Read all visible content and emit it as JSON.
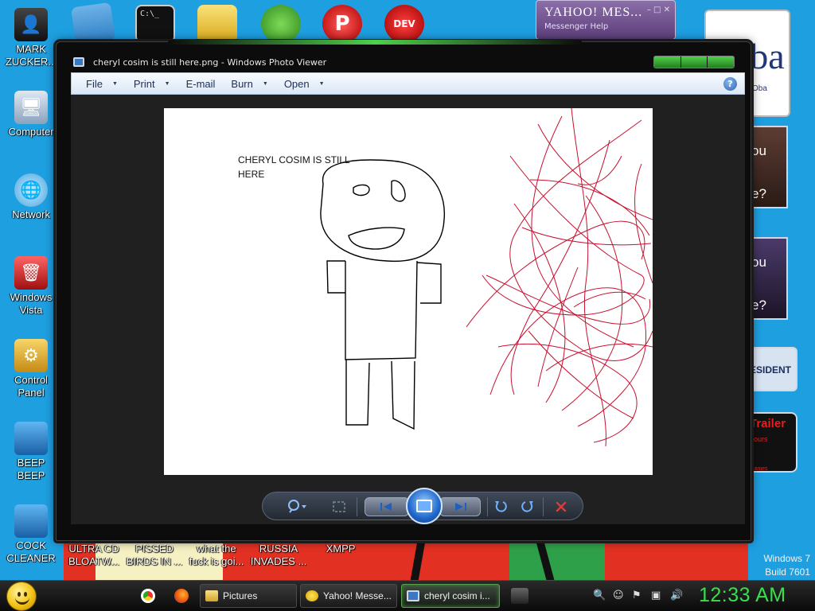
{
  "desktop": {
    "left_icons": [
      {
        "label_line1": "MARK",
        "label_line2": "ZUCKER...",
        "icon": "person-icon"
      },
      {
        "label_line1": "Computer",
        "label_line2": "",
        "icon": "computer-icon"
      },
      {
        "label_line1": "Network",
        "label_line2": "",
        "icon": "network-icon"
      },
      {
        "label_line1": "Windows",
        "label_line2": "Vista",
        "icon": "recycle-bin-icon"
      },
      {
        "label_line1": "Control",
        "label_line2": "Panel",
        "icon": "control-panel-icon"
      },
      {
        "label_line1": "BEEP",
        "label_line2": "BEEP",
        "icon": "file-icon"
      },
      {
        "label_line1": "COCK",
        "label_line2": "CLEANER",
        "icon": "file-icon"
      }
    ],
    "bottom_icons": [
      {
        "line1": "ULTRA CD",
        "line2": "BLOATW..."
      },
      {
        "line1": "PISSED",
        "line2": "BIRDS IN ..."
      },
      {
        "line1": "what the",
        "line2": "fuck is goi..."
      },
      {
        "line1": "RUSSIA",
        "line2": "INVADES ..."
      },
      {
        "line1": "XMPP",
        "line2": ""
      }
    ],
    "watermark": {
      "line1": "Windows 7",
      "line2": "Build 7601"
    },
    "widgets": {
      "yahoo_logo": "YAHOO! MES...",
      "yahoo_links": "Messenger    Help",
      "obama_big": "Oba",
      "obama_small": "ckOba",
      "poll1_line1": "ou",
      "poll1_line2": "e?",
      "poll2_line1": "ou",
      "poll2_line2": "e?",
      "president": "ESIDENT",
      "trailer_title": "Trailer",
      "trailer_sub": "hours",
      "trailer_foot": "Games"
    }
  },
  "window": {
    "title": "cheryl cosim is still here.png - Windows Photo Viewer",
    "menu": [
      {
        "label": "File",
        "has_arrow": true
      },
      {
        "label": "Print",
        "has_arrow": true
      },
      {
        "label": "E-mail",
        "has_arrow": false
      },
      {
        "label": "Burn",
        "has_arrow": true
      },
      {
        "label": "Open",
        "has_arrow": true
      }
    ],
    "help_label": "?",
    "photo": {
      "text_line1": "CHERYL COSIM IS STILL",
      "text_line2": "HERE",
      "drawing_colors": {
        "figure": "#000000",
        "scribble": "#c8102e"
      }
    },
    "controls": [
      "zoom-icon",
      "fit-icon",
      "previous-icon",
      "slideshow-icon",
      "next-icon",
      "rotate-left-icon",
      "rotate-right-icon",
      "delete-icon"
    ]
  },
  "taskbar": {
    "buttons": [
      {
        "label": "Pictures",
        "icon": "folder-icon",
        "active": false
      },
      {
        "label": "Yahoo! Messe...",
        "icon": "yahoo-icon",
        "active": false
      },
      {
        "label": "cheryl cosim i...",
        "icon": "photo-viewer-icon",
        "active": true
      }
    ],
    "clock": "12:33 AM",
    "colors": {
      "clock": "#37e04a",
      "accent": "#4fd04a"
    }
  }
}
